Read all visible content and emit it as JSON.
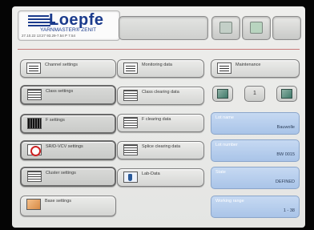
{
  "brand": {
    "name": "Loepfe",
    "product": "YARNMASTER® ZENIT",
    "info_line": "27.10.22   13:27   93.29-7.54   P 7.54"
  },
  "menu": {
    "channel_settings": "Channel settings",
    "class_settings": "Class settings",
    "f_settings": "F settings",
    "srvd_vcv_settings": "SR/D-VCV settings",
    "cluster_settings": "Cluster settings",
    "base_settings": "Base settings",
    "monitoring_data": "Monitoring data",
    "class_clearing_data": "Class clearing data",
    "f_clearing_data": "F clearing data",
    "splice_clearing_data": "Splice clearing data",
    "lab_data": "Lab-Data",
    "maintenance": "Maintenance",
    "page_number": "1"
  },
  "info": {
    "lot_name_label": "Lot name",
    "lot_name_value": "Bauwolle",
    "lot_number_label": "Lot number",
    "lot_number_value": "BW 0015",
    "state_label": "State",
    "state_value": "DEFINED",
    "working_range_label": "Working range",
    "working_range_value": "1 - 38"
  },
  "icons": {
    "logo": "loepfe-logo-icon",
    "header_1": "checklist-icon",
    "header_2": "export-icon",
    "channel": "channel-lines-icon",
    "class": "class-matrix-icon",
    "f": "f-matrix-icon",
    "srvd": "no-sign-icon",
    "cluster": "cluster-matrix-icon",
    "base": "base-icon",
    "monitoring": "document-icon",
    "lab": "flask-icon",
    "maintenance": "tools-icon",
    "map_left": "map-left-icon",
    "map_right": "map-right-icon"
  },
  "colors": {
    "info_panel": "#a9c4e8",
    "accent_divider": "#c77a7a",
    "brand_blue": "#1b3b8c"
  }
}
